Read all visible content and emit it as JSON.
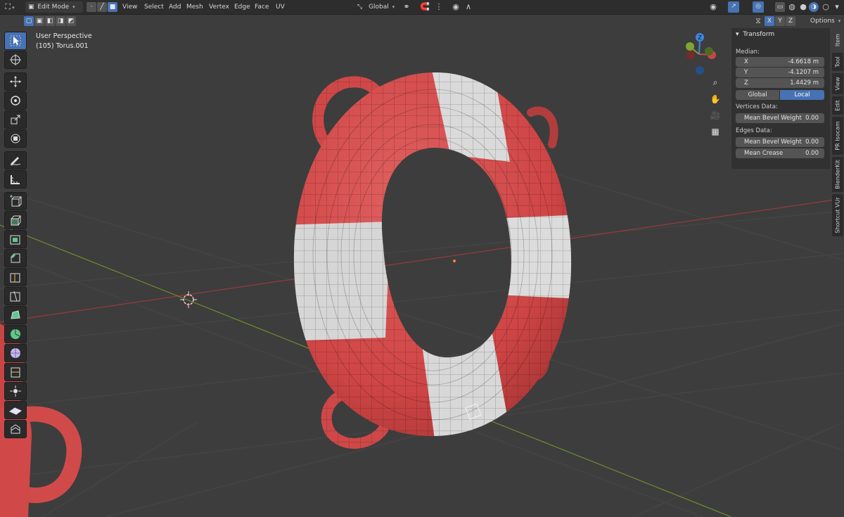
{
  "header": {
    "mode_label": "Edit Mode",
    "menus": [
      "View",
      "Select",
      "Add",
      "Mesh",
      "Vertex",
      "Edge",
      "Face",
      "UV"
    ],
    "transform_orientation": "Global",
    "options_label": "Options",
    "axis_toggles": [
      "X",
      "Y",
      "Z"
    ]
  },
  "viewport": {
    "view_name": "User Perspective",
    "object_info": "(105) Torus.001"
  },
  "gizmo": {
    "z_label": "Z",
    "x_label": "X",
    "y_label": "Y"
  },
  "npanel": {
    "section_title": "Transform",
    "median_label": "Median:",
    "x_label": "X",
    "x_value": "-4.6618 m",
    "y_label": "Y",
    "y_value": "-4.1207 m",
    "z_label": "Z",
    "z_value": "1.4429 m",
    "global_label": "Global",
    "local_label": "Local",
    "vertices_label": "Vertices Data:",
    "vert_bevel_label": "Mean Bevel Weight",
    "vert_bevel_value": "0.00",
    "edges_label": "Edges Data:",
    "edge_bevel_label": "Mean Bevel Weight",
    "edge_bevel_value": "0.00",
    "crease_label": "Mean Crease",
    "crease_value": "0.00"
  },
  "sidetabs": [
    "Item",
    "Tool",
    "View",
    "Edit",
    "PR Isocam",
    "BlenderKit",
    "Shortcut VUr"
  ],
  "colors": {
    "accent": "#4772b3",
    "buoy_red": "#d64e4e",
    "buoy_white": "#d9d9d9",
    "x_axis": "#c8464a",
    "y_axis": "#7fa532",
    "z_axis": "#3e87e3"
  }
}
